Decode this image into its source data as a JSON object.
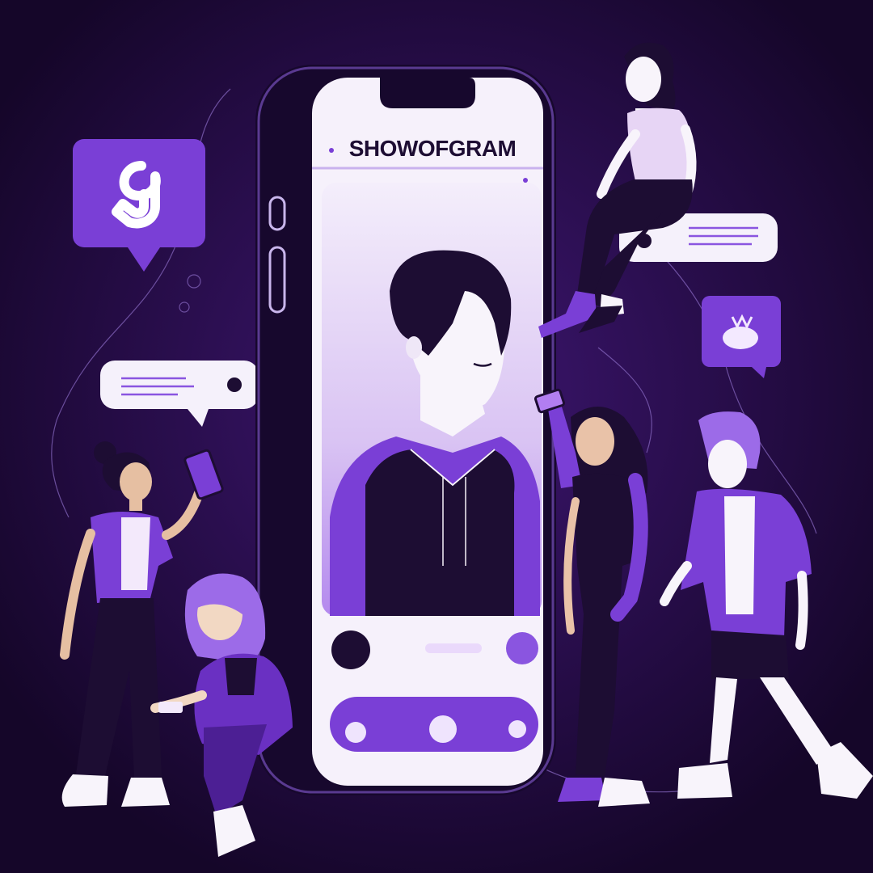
{
  "app": {
    "title": "SHOWOFGRAM"
  },
  "colors": {
    "background": "#1c0838",
    "accent": "#7a3fd6",
    "accent_light": "#a07de8",
    "screen": "#f6f1fb",
    "ink": "#1d0d33"
  },
  "icons": [
    "music-note-card-icon",
    "heart-chat-icon",
    "share-button-icon",
    "record-button-icon"
  ]
}
